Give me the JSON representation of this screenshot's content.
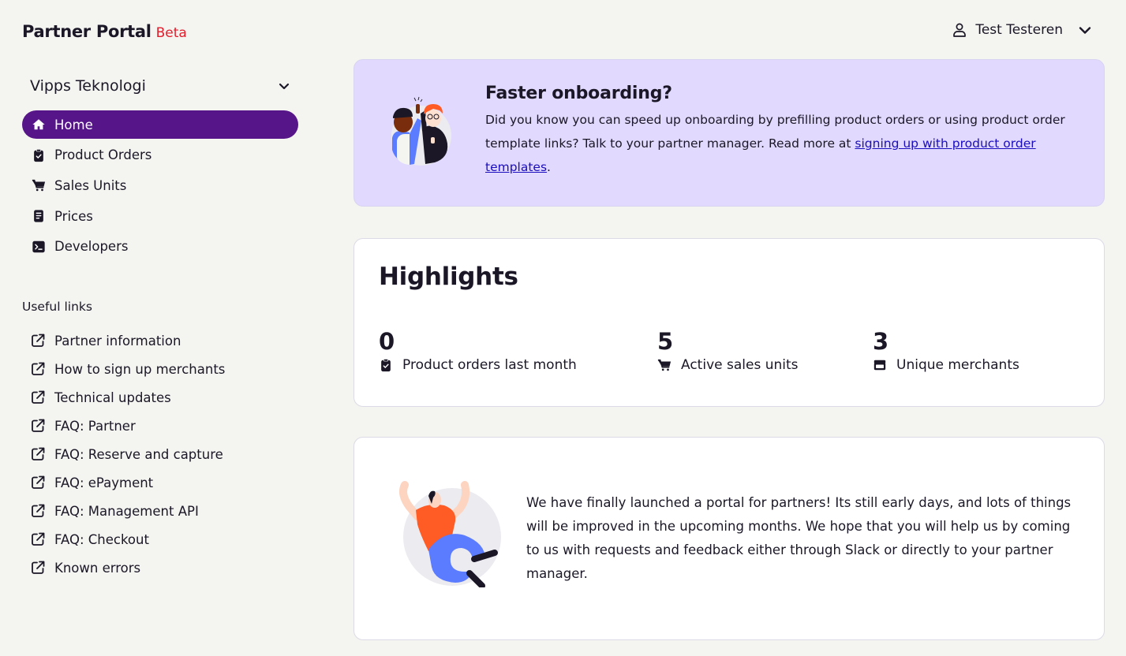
{
  "brand": {
    "title": "Partner Portal",
    "badge": "Beta"
  },
  "org_selector": {
    "selected": "Vipps Teknologi"
  },
  "user_menu": {
    "name": "Test Testeren"
  },
  "nav": {
    "items": [
      {
        "label": "Home",
        "icon": "home-icon",
        "active": true
      },
      {
        "label": "Product Orders",
        "icon": "clipboard-check-icon",
        "active": false
      },
      {
        "label": "Sales Units",
        "icon": "cart-icon",
        "active": false
      },
      {
        "label": "Prices",
        "icon": "document-icon",
        "active": false
      },
      {
        "label": "Developers",
        "icon": "terminal-icon",
        "active": false
      }
    ]
  },
  "useful_links": {
    "title": "Useful links",
    "items": [
      {
        "label": "Partner information"
      },
      {
        "label": "How to sign up merchants"
      },
      {
        "label": "Technical updates"
      },
      {
        "label": "FAQ: Partner"
      },
      {
        "label": "FAQ: Reserve and capture"
      },
      {
        "label": "FAQ: ePayment"
      },
      {
        "label": "FAQ: Management API"
      },
      {
        "label": "FAQ: Checkout"
      },
      {
        "label": "Known errors"
      }
    ]
  },
  "promo": {
    "title": "Faster onboarding?",
    "body_before_link": "Did you know you can speed up onboarding by prefilling product orders or using product order template links? Talk to your partner manager. Read more at ",
    "link_text": "signing up with product order templates",
    "body_after_link": "."
  },
  "highlights": {
    "title": "Highlights",
    "stats": [
      {
        "value": "0",
        "label": "Product orders last month",
        "icon": "clipboard-check-icon"
      },
      {
        "value": "5",
        "label": "Active sales units",
        "icon": "cart-icon"
      },
      {
        "value": "3",
        "label": "Unique merchants",
        "icon": "store-icon"
      }
    ]
  },
  "welcome": {
    "text": "We have finally launched a portal for partners! Its still early days, and lots of things will be improved in the upcoming months. We hope that you will help us by coming to us with requests and feedback either through Slack or directly to your partner manager."
  },
  "colors": {
    "accent": "#56168a",
    "beta": "#e31e2c",
    "promo_bg": "#e1d9fe",
    "link": "#1a0dbd",
    "page_bg": "#f4f4f1"
  }
}
